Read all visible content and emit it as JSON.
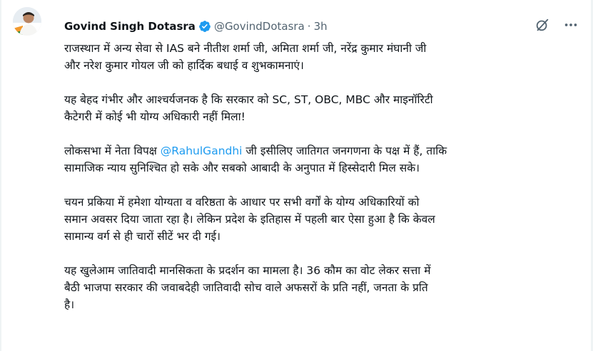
{
  "tweet": {
    "author_name": "Govind Singh Dotasra",
    "handle": "@GovindDotasra",
    "separator": "·",
    "time": "3h",
    "verified": true,
    "colors": {
      "accent": "#1d9bf0",
      "text": "#0f1419",
      "secondary": "#536471"
    },
    "icons": [
      "verified-badge-icon",
      "grok-icon",
      "more-options-icon"
    ],
    "paragraphs": [
      {
        "lines": [
          "राजस्थान में अन्य सेवा से IAS बने नीतीश शर्मा जी, अमिता शर्मा जी, नरेंद्र कुमार मंघानी जी",
          "और नरेश कुमार गोयल जी को हार्दिक बधाई व शुभकामनाएं।"
        ]
      },
      {
        "lines": [
          "यह बेहद गंभीर और आश्चर्यजनक है कि सरकार को SC, ST, OBC, MBC और माइनॉरिटी",
          "कैटेगरी में कोई भी योग्य अधिकारी नहीं मिला!"
        ]
      },
      {
        "line1_before": "लोकसभा में नेता विपक्ष ",
        "mention": "@RahulGandhi",
        "line1_after": " जी इसीलिए जातिगत जनगणना के पक्ष में हैं, ताकि",
        "line2": "सामाजिक न्याय सुनिश्चित हो सके और सबको आबादी के अनुपात में हिस्सेदारी मिल सके।"
      },
      {
        "lines": [
          "चयन प्रकिया में हमेशा योग्यता व वरिष्ठता के आधार पर सभी वर्गों के योग्य अधिकारियों को",
          "समान अवसर दिया जाता रहा है। लेकिन प्रदेश के इतिहास में पहली बार ऐसा हुआ है कि केवल",
          "सामान्य वर्ग से ही चारों सीटें भर दी गई।"
        ]
      },
      {
        "lines": [
          "यह खुलेआम जातिवादी मानसिकता के प्रदर्शन का मामला है। 36 कौम का वोट लेकर सत्ता में",
          "बैठी भाजपा सरकार की जवाबदेही जातिवादी सोच वाले अफसरों के प्रति नहीं, जनता के प्रति",
          "है।"
        ]
      }
    ]
  }
}
